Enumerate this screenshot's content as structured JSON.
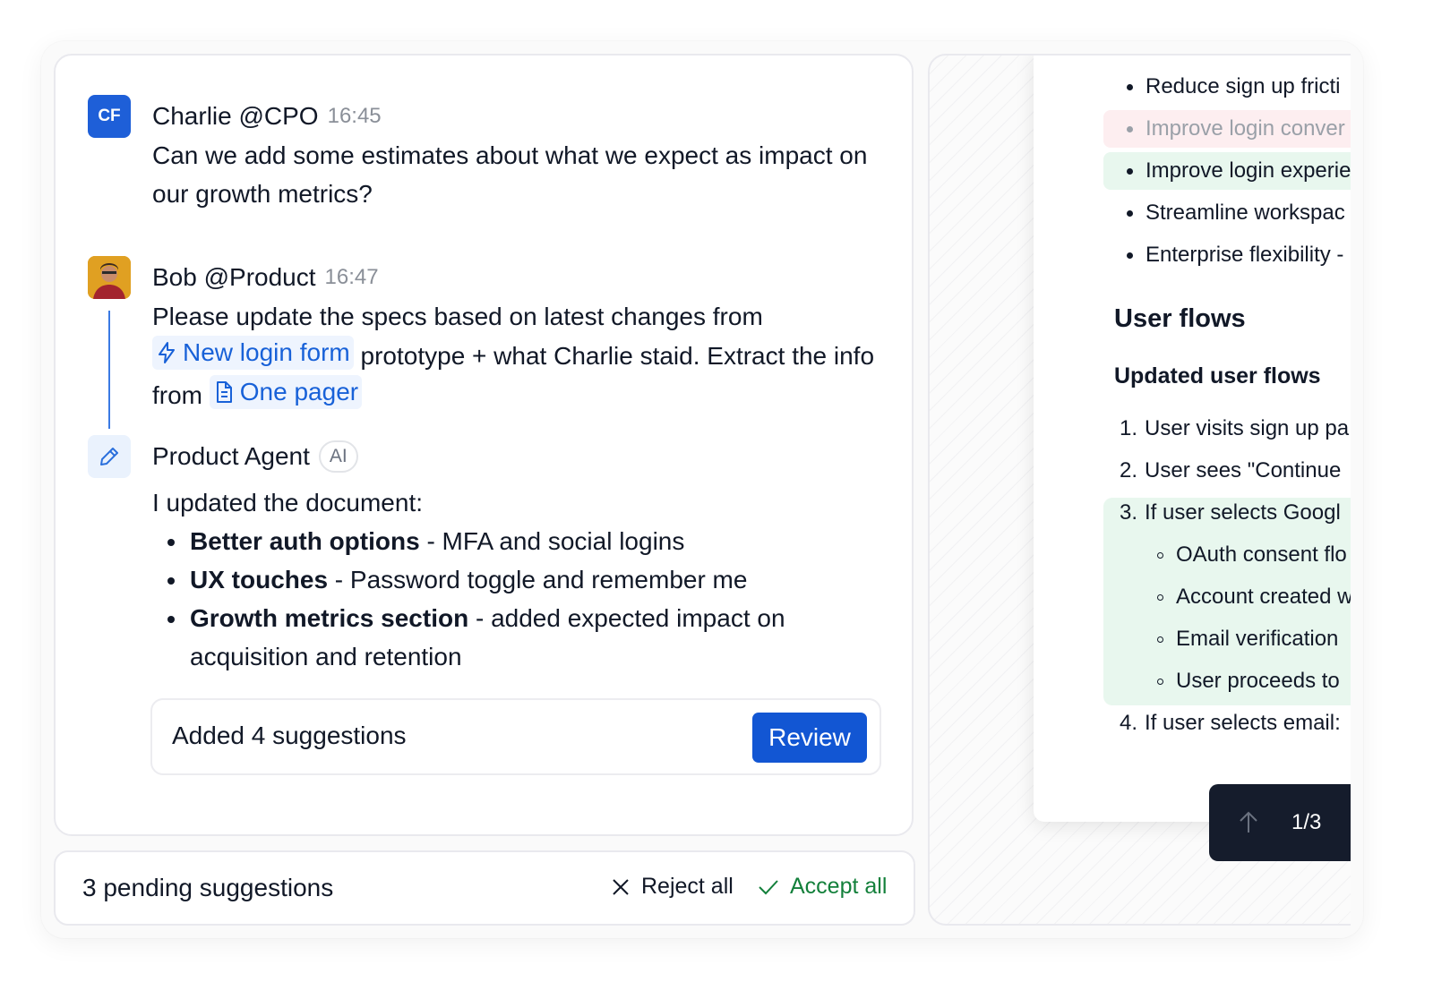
{
  "chat": {
    "messages": [
      {
        "initials": "CF",
        "author": "Charlie @CPO",
        "time": "16:45",
        "text": "Can we add some estimates about what we expect as impact on our growth metrics?"
      },
      {
        "author": "Bob @Product",
        "time": "16:47",
        "text_before": "Please update the specs based on latest changes from",
        "chip1": "New login form",
        "text_middle": "prototype + what Charlie staid. Extract the info from",
        "chip2": "One pager"
      },
      {
        "author": "Product Agent",
        "badge": "AI",
        "intro": "I updated the document:",
        "changes": [
          {
            "title": "Better auth options",
            "detail": " - MFA and social logins"
          },
          {
            "title": "UX touches",
            "detail": " - Password toggle and remember me"
          },
          {
            "title": "Growth metrics section",
            "detail": " - added expected impact on acquisition and retention"
          }
        ]
      }
    ],
    "suggestions_box": {
      "text": "Added 4 suggestions",
      "button": "Review"
    }
  },
  "pending": {
    "text": "3 pending suggestions",
    "reject": "Reject all",
    "accept": "Accept all"
  },
  "doc": {
    "bullets": [
      {
        "text": "Reduce sign up fricti",
        "state": "normal"
      },
      {
        "text": "Improve login conver",
        "state": "removed"
      },
      {
        "text": "Improve login experie",
        "state": "added"
      },
      {
        "text": "Streamline workspac",
        "state": "normal"
      },
      {
        "text": "Enterprise flexibility -",
        "state": "normal"
      }
    ],
    "heading": "User flows",
    "subheading": "Updated user flows",
    "steps": [
      {
        "num": "1.",
        "text": "User visits sign up pa"
      },
      {
        "num": "2.",
        "text": "User sees \"Continue"
      },
      {
        "num": "3.",
        "text": "If user selects Googl"
      },
      {
        "num": "4.",
        "text": "If user selects email:"
      }
    ],
    "substeps": [
      "OAuth consent flo",
      "Account created w",
      "Email verification",
      "User proceeds to"
    ],
    "pager": "1/3"
  },
  "colors": {
    "accent": "#1256d3",
    "accept": "#13803b",
    "added_bg": "#e8f7ee",
    "removed_bg": "#fdeef0",
    "pager_bg": "#151c2c"
  }
}
